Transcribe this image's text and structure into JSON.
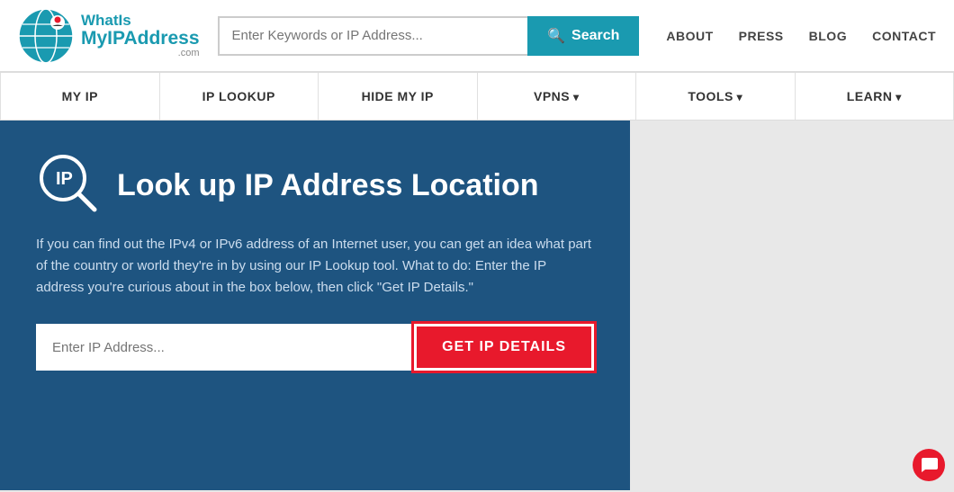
{
  "header": {
    "logo": {
      "whatis": "WhatIs",
      "myip": "MyIP",
      "address": "Address",
      "com": ".com"
    },
    "search": {
      "placeholder": "Enter Keywords or IP Address...",
      "button_label": "Search"
    },
    "top_nav": [
      {
        "label": "ABOUT",
        "id": "about"
      },
      {
        "label": "PRESS",
        "id": "press"
      },
      {
        "label": "BLOG",
        "id": "blog"
      },
      {
        "label": "CONTACT",
        "id": "contact"
      }
    ]
  },
  "navbar": {
    "items": [
      {
        "label": "MY IP",
        "dropdown": false
      },
      {
        "label": "IP LOOKUP",
        "dropdown": false
      },
      {
        "label": "HIDE MY IP",
        "dropdown": false
      },
      {
        "label": "VPNS",
        "dropdown": true
      },
      {
        "label": "TOOLS",
        "dropdown": true
      },
      {
        "label": "LEARN",
        "dropdown": true
      }
    ]
  },
  "hero": {
    "title": "Look up IP Address Location",
    "description": "If you can find out the IPv4 or IPv6 address of an Internet user, you can get an idea what part of the country or world they're in by using our IP Lookup tool. What to do: Enter the IP address you're curious about in the box below, then click \"Get IP Details.\"",
    "ip_input_placeholder": "Enter IP Address...",
    "cta_button": "GET IP DETAILS"
  }
}
